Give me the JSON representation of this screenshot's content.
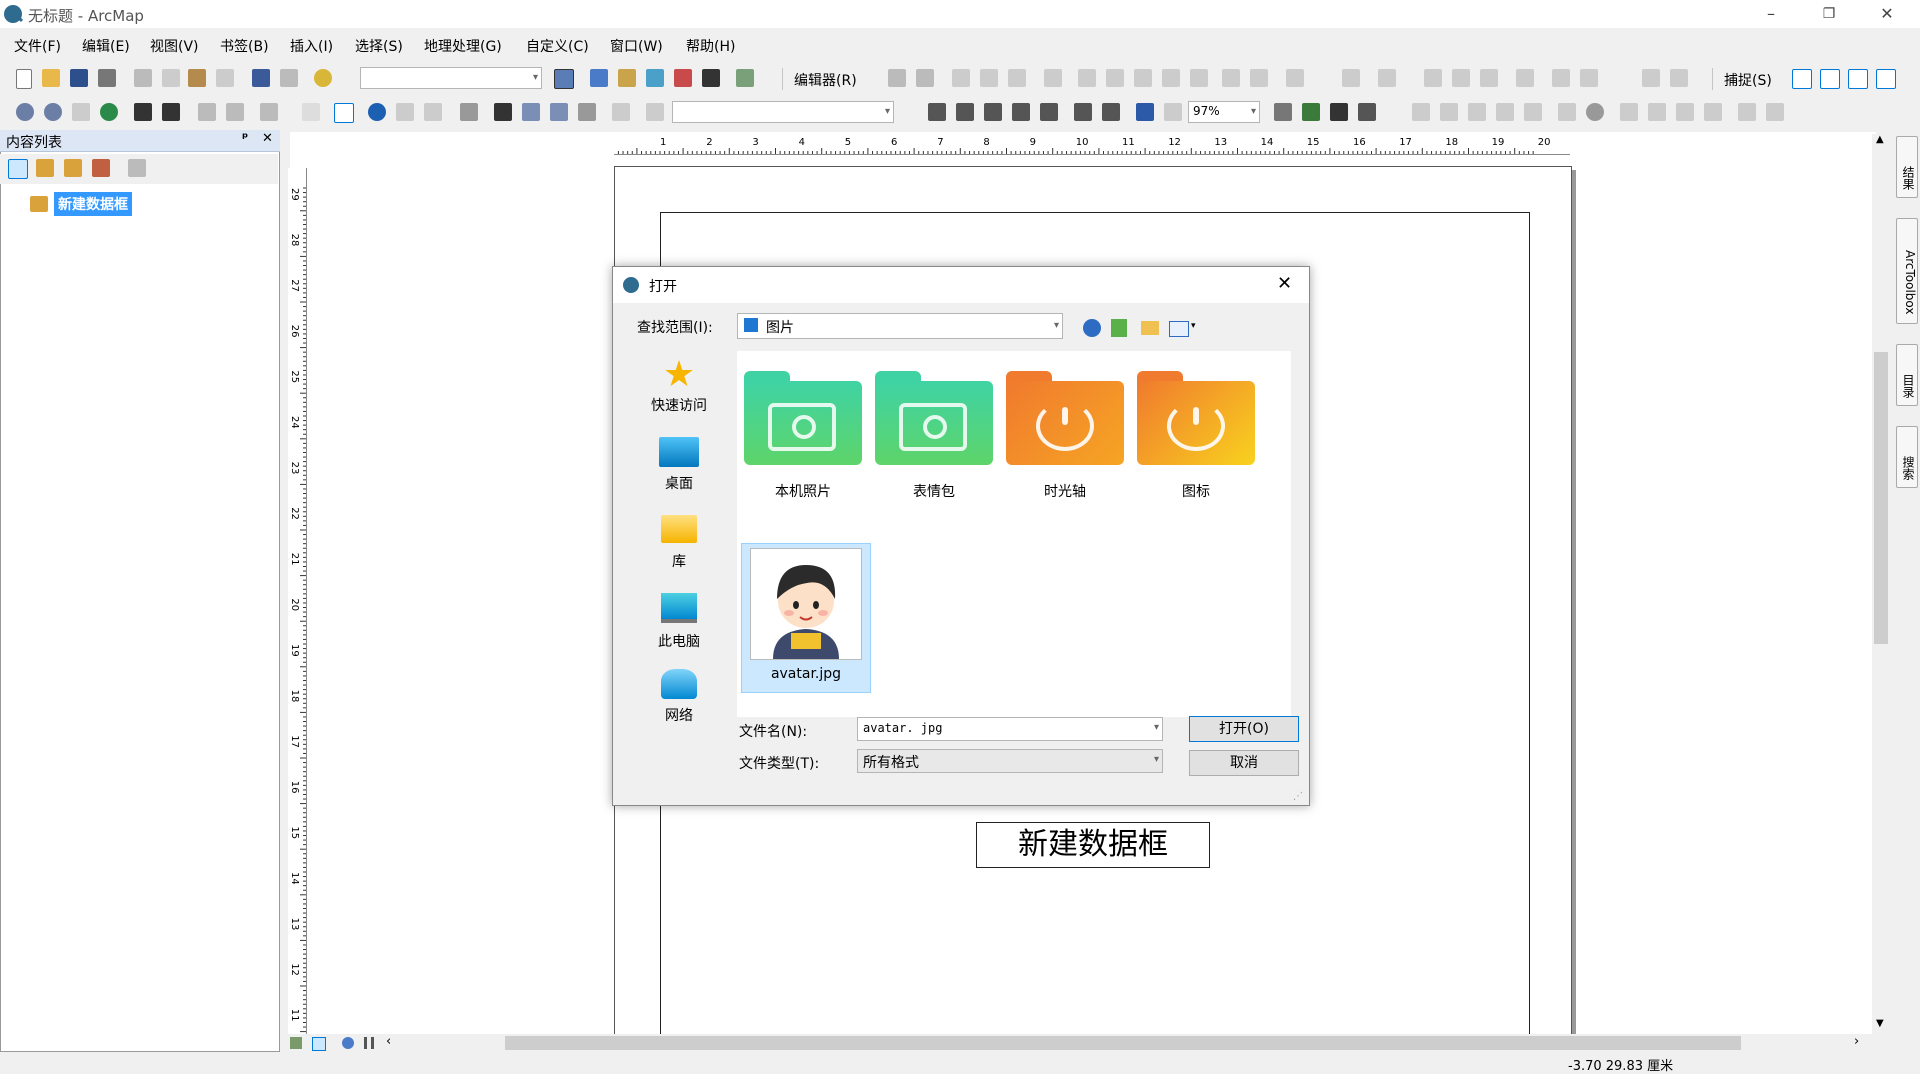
{
  "window": {
    "title": "无标题 - ArcMap",
    "minimize": "–",
    "restore": "❐",
    "close": "✕"
  },
  "menu": [
    "文件(F)",
    "编辑(E)",
    "视图(V)",
    "书签(B)",
    "插入(I)",
    "选择(S)",
    "地理处理(G)",
    "自定义(C)",
    "窗口(W)",
    "帮助(H)"
  ],
  "toolbar": {
    "editor_label": "编辑器(R)",
    "snap_label": "捕捉(S)",
    "zoom_value": "97%"
  },
  "toc": {
    "title": "内容列表",
    "pin": "ᵖ",
    "close": "✕",
    "data_frame": "新建数据框"
  },
  "layout": {
    "legend_text": "新建数据框",
    "hruler_ticks": [
      "1",
      "2",
      "3",
      "4",
      "5",
      "6",
      "7",
      "8",
      "9",
      "10",
      "11",
      "12",
      "13",
      "14",
      "15",
      "16",
      "17",
      "18",
      "19",
      "20"
    ],
    "vruler_ticks": [
      "29",
      "28",
      "27",
      "26",
      "25",
      "24",
      "23",
      "22",
      "21",
      "20",
      "19",
      "18",
      "17",
      "16",
      "15",
      "14",
      "13",
      "12",
      "11"
    ]
  },
  "right_dock": [
    "结果",
    "ArcToolbox",
    "目录",
    "搜索"
  ],
  "status": {
    "coords": "-3.70  29.83 厘米"
  },
  "dialog": {
    "title": "打开",
    "look_in_label": "查找范围(I):",
    "look_in_value": "图片",
    "places": [
      "快速访问",
      "桌面",
      "库",
      "此电脑",
      "网络"
    ],
    "files": [
      {
        "name": "本机照片",
        "kind": "camera",
        "color_top": "#3fd3a4",
        "color_bottom": "#5ed46a"
      },
      {
        "name": "表情包",
        "kind": "camera",
        "color_top": "#3fd3a4",
        "color_bottom": "#5ed46a"
      },
      {
        "name": "时光轴",
        "kind": "smile",
        "color_top": "#f07a2e",
        "color_bottom": "#f6a524"
      },
      {
        "name": "图标",
        "kind": "smile",
        "color_top": "#f07a2e",
        "color_bottom": "#f8d21e"
      }
    ],
    "selected_file": "avatar.jpg",
    "filename_label": "文件名(N):",
    "filename_value": "avatar. jpg",
    "filetype_label": "文件类型(T):",
    "filetype_value": "所有格式",
    "open_button": "打开(O)",
    "cancel_button": "取消"
  },
  "colors": {
    "accent": "#0078d7",
    "selection": "#cce8ff",
    "toc_highlight": "#3399ff"
  }
}
